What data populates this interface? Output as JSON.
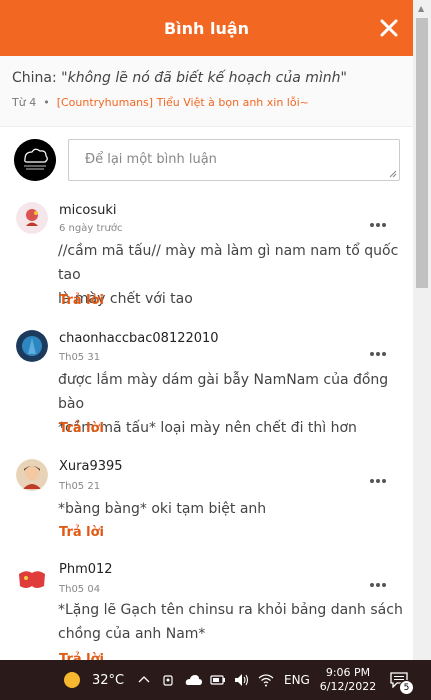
{
  "header": {
    "title": "Bình luận",
    "close_icon": "close-icon"
  },
  "context": {
    "prefix": "China:",
    "quote": "\"không lẽ nó đã biết kế hoạch của mình\"",
    "chapter": "Từ 4",
    "dot": "•",
    "story_link": "[Countryhumans] Tiểu Việt à bọn anh xin lỗi~"
  },
  "composer": {
    "placeholder": "Để lại một bình luận"
  },
  "comments": [
    {
      "user": "micosuki",
      "time": "6 ngày trước",
      "lines": [
        "//cầm mã tấu// mày mà làm gì nam nam tổ quốc tao",
        "là mày chết với tao"
      ],
      "reply": "Trả lời"
    },
    {
      "user": "chaonhaccbac08122010",
      "time": "Th05 31",
      "lines": [
        "được lắm mày dám gài bẫy NamNam của đồng bào",
        "*cầm mã tấu* loại mày nên chết đi thì hơn"
      ],
      "reply": "Trả lời"
    },
    {
      "user": "Xura9395",
      "time": "Th05 21",
      "lines": [
        "*bàng bàng* oki tạm biệt anh"
      ],
      "reply": "Trả lời"
    },
    {
      "user": "Phm012",
      "time": "Th05 04",
      "lines": [
        "*Lặng lẽ Gạch tên chinsu ra khỏi bảng danh sách",
        "chồng của anh Nam*"
      ],
      "reply": "Trả lời"
    }
  ],
  "taskbar": {
    "temperature": "32°C",
    "language": "ENG",
    "time": "9:06 PM",
    "date": "6/12/2022",
    "notification_count": "5"
  },
  "colors": {
    "accent": "#f26722",
    "reply": "#e05a14"
  }
}
